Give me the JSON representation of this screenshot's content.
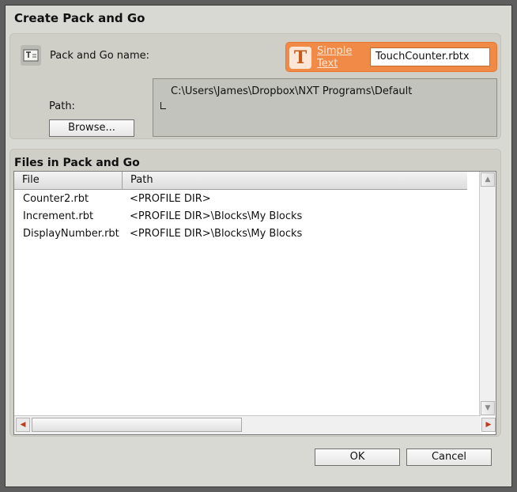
{
  "dialog": {
    "title": "Create Pack and Go"
  },
  "name_section": {
    "label": "Pack and Go name:",
    "icon": "text-entry-icon",
    "simple_text_link": "Simple Text",
    "simple_text_icon": "text-T-icon",
    "filename_value": "TouchCounter.rbtx"
  },
  "path_section": {
    "label": "Path:",
    "browse_label": "Browse...",
    "path_value": "C:\\Users\\James\\Dropbox\\NXT Programs\\Default"
  },
  "files_section": {
    "title": "Files in Pack and Go",
    "columns": [
      "File",
      "Path"
    ],
    "rows": [
      {
        "file": "Counter2.rbt",
        "path": "<PROFILE DIR>"
      },
      {
        "file": "Increment.rbt",
        "path": "<PROFILE DIR>\\Blocks\\My Blocks"
      },
      {
        "file": "DisplayNumber.rbt",
        "path": "<PROFILE DIR>\\Blocks\\My Blocks"
      }
    ]
  },
  "buttons": {
    "ok": "OK",
    "cancel": "Cancel"
  },
  "colors": {
    "accent": "#f08a46",
    "background": "#d9d9d4"
  }
}
